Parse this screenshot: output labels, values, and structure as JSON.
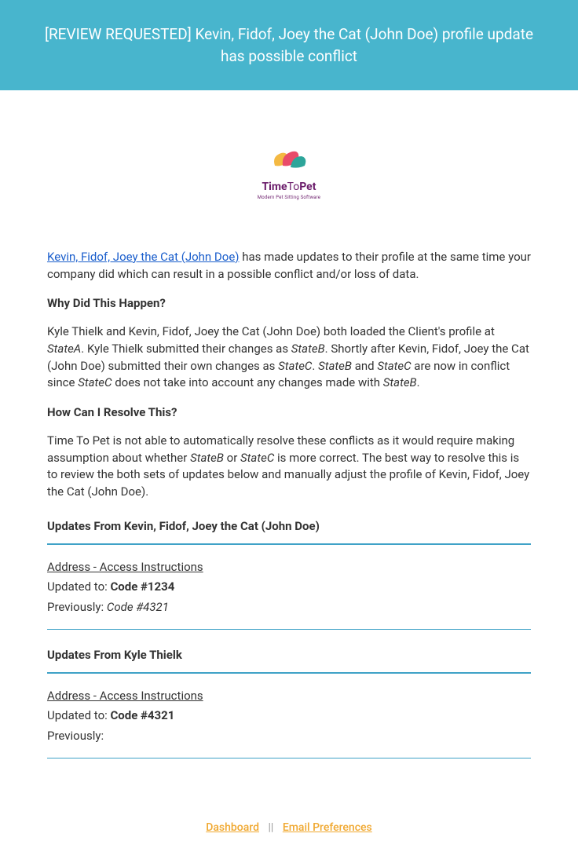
{
  "header": {
    "title": "[REVIEW REQUESTED] Kevin, Fidof, Joey the Cat (John Doe) profile update has possible conflict"
  },
  "logo": {
    "brand_left": "Time",
    "brand_mid": "To",
    "brand_right": "Pet",
    "tagline": "Modern Pet Sitting Software"
  },
  "body": {
    "client_link_text": "Kevin, Fidof, Joey the Cat (John Doe)",
    "intro_rest": " has made updates to their profile at the same time your company did which can result in a possible conflict and/or loss of data.",
    "q1": "Why Did This Happen?",
    "p2_a": "Kyle Thielk and Kevin, Fidof, Joey the Cat (John Doe) both loaded the Client's profile at ",
    "stateA": "StateA",
    "p2_b": ". Kyle Thielk submitted their changes as ",
    "stateB": "StateB",
    "p2_c": ". Shortly after Kevin, Fidof, Joey the Cat (John Doe) submitted their own changes as ",
    "stateC": "StateC",
    "p2_d": ". ",
    "p2_e": " and ",
    "p2_f": " are now in conflict since ",
    "p2_g": " does not take into account any changes made with ",
    "p2_h": ".",
    "q2": "How Can I Resolve This?",
    "p3_a": "Time To Pet is not able to automatically resolve these conflicts as it would require making assumption about whether ",
    "p3_b": " or ",
    "p3_c": " is more correct. The best way to resolve this is to review the both sets of updates below and manually adjust the profile of Kevin, Fidof, Joey the Cat (John Doe).",
    "updates1_title": "Updates From Kevin, Fidof, Joey the Cat (John Doe)",
    "updates2_title": "Updates From Kyle Thielk",
    "field_label": "Address - Access Instructions",
    "updated_to_label": "Updated to: ",
    "previously_label": "Previously: ",
    "u1_updated": "Code #1234",
    "u1_prev": "Code #4321",
    "u2_updated": "Code #4321",
    "u2_prev": ""
  },
  "footer": {
    "dashboard": "Dashboard",
    "sep": "||",
    "email_prefs": "Email Preferences"
  }
}
